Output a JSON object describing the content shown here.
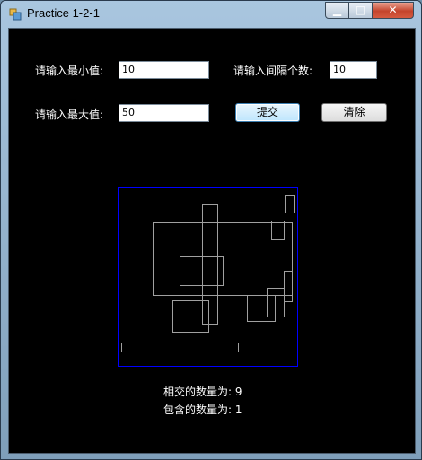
{
  "window": {
    "title": "Practice 1-2-1",
    "minimize_glyph": "▁",
    "maximize_glyph": "□",
    "close_glyph": "✕"
  },
  "form": {
    "min_label": "请输入最小值:",
    "min_value": "10",
    "interval_label": "请输入间隔个数:",
    "interval_value": "10",
    "max_label": "请输入最大值:",
    "max_value": "50",
    "submit_label": "提交",
    "clear_label": "清除"
  },
  "results": {
    "intersect_label": "相交的数量为:",
    "intersect_count": "9",
    "contain_label": "包含的数量为:",
    "contain_count": "1"
  },
  "colors": {
    "canvas_border": "#0000ff",
    "rect_stroke": "#a0a0a0",
    "client_background": "#000000"
  }
}
